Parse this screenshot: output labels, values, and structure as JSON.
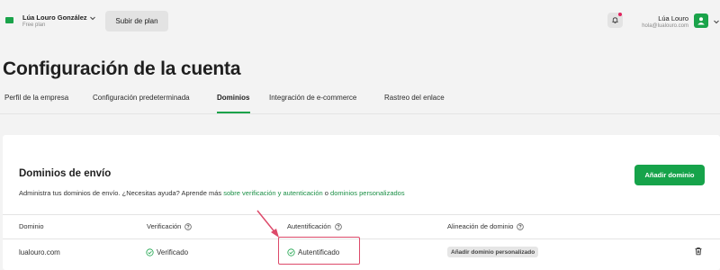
{
  "account": {
    "name": "Lúa Louro González",
    "plan": "Free plan",
    "upgrade_label": "Subir de plan"
  },
  "user": {
    "name": "Lúa Louro",
    "email": "hola@lualouro.com"
  },
  "page": {
    "title": "Configuración de la cuenta"
  },
  "tabs": [
    {
      "label": "Perfil de la empresa",
      "active": false
    },
    {
      "label": "Configuración predeterminada",
      "active": false
    },
    {
      "label": "Dominios",
      "active": true
    },
    {
      "label": "Integración de e-commerce",
      "active": false
    },
    {
      "label": "Rastreo del enlace",
      "active": false
    }
  ],
  "card": {
    "title": "Dominios de envío",
    "desc_prefix": "Administra tus dominios de envío. ¿Necesitas ayuda? Aprende más ",
    "link_1": "sobre verificación y autenticación",
    "desc_mid": " o ",
    "link_2": "dominios personalizados",
    "add_button": "Añadir dominio"
  },
  "table": {
    "headers": {
      "domain": "Dominio",
      "verification": "Verificación",
      "authentication": "Autentificación",
      "alignment": "Alineación de dominio"
    },
    "rows": [
      {
        "domain": "lualouro.com",
        "verification": "Verificado",
        "authentication": "Autentificado",
        "alignment_badge": "Añadir dominio personalizado"
      }
    ]
  },
  "colors": {
    "accent": "#16a34a",
    "highlight": "#dd4a6a",
    "notification": "#e0245e"
  },
  "icons": {
    "notifications": "bell-icon",
    "avatar": "user-icon",
    "info": "info-circle-icon",
    "status": "check-circle-icon",
    "delete": "trash-icon"
  }
}
